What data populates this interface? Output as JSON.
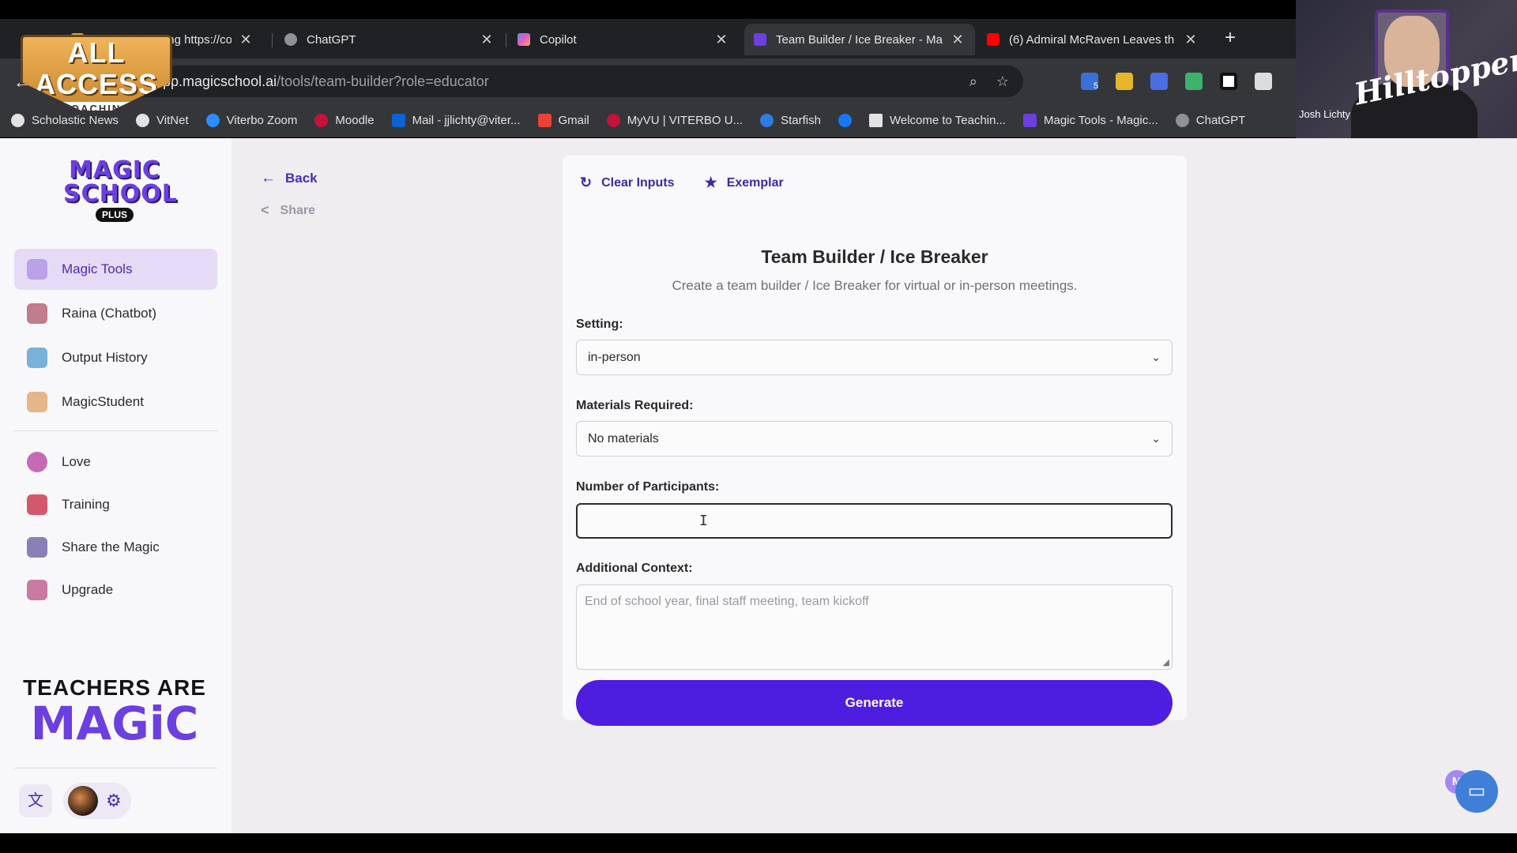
{
  "browser": {
    "tabs": [
      {
        "title": "ALand Coaching https://copilot.",
        "color": "#e4a23b"
      },
      {
        "title": "ChatGPT",
        "color": "#8e9196"
      },
      {
        "title": "Copilot",
        "color": "#5b8ef0"
      },
      {
        "title": "Team Builder / Ice Breaker - Ma",
        "color": "#6b3fe0"
      },
      {
        "title": "(6) Admiral McRaven Leaves th",
        "color": "#ff0000"
      }
    ],
    "new_tab": "+",
    "close_glyph": "✕",
    "url_host": "app.magicschool.ai",
    "url_path": "/tools/team-builder?role=educator",
    "extension_badge": "5",
    "bookmarks": [
      {
        "label": "Scholastic News",
        "color": "#e2e2e2"
      },
      {
        "label": "VitNet",
        "color": "#e2e2e2"
      },
      {
        "label": "Viterbo Zoom",
        "color": "#2d8cff"
      },
      {
        "label": "Moodle",
        "color": "#c4123b"
      },
      {
        "label": "Mail - jjlichty@viter...",
        "color": "#0a64d6"
      },
      {
        "label": "Gmail",
        "color": "#ea4335"
      },
      {
        "label": "MyVU | VITERBO U...",
        "color": "#c4123b"
      },
      {
        "label": "Starfish",
        "color": "#2a7de1"
      },
      {
        "label": "",
        "color": "#1877f2"
      },
      {
        "label": "Welcome to Teachin...",
        "color": "#e2e2e2"
      },
      {
        "label": "Magic Tools - Magic...",
        "color": "#6b3fe0"
      },
      {
        "label": "ChatGPT",
        "color": "#8e9196"
      }
    ]
  },
  "overlay": {
    "logo_line1": "ALL ACCESS",
    "logo_line2": "COACHING",
    "webcam_name": "Josh Lichty",
    "webcam_brand": "Hilltoppers"
  },
  "sidebar": {
    "logo_line1": "MAGIC",
    "logo_line2": "SCHOOL",
    "logo_badge": "PLUS",
    "items": [
      {
        "label": "Magic Tools",
        "color": "#b9a2e8"
      },
      {
        "label": "Raina (Chatbot)",
        "color": "#c07d8a"
      },
      {
        "label": "Output History",
        "color": "#7ab1d8"
      },
      {
        "label": "MagicStudent",
        "color": "#e5b68a"
      }
    ],
    "items2": [
      {
        "label": "Love",
        "color": "#c56bb6"
      },
      {
        "label": "Training",
        "color": "#d4586d"
      },
      {
        "label": "Share the Magic",
        "color": "#8b7fb8"
      },
      {
        "label": "Upgrade",
        "color": "#c97aa3"
      }
    ],
    "tagline_line1": "TEACHERS ARE",
    "tagline_line2": "MAGiC"
  },
  "page": {
    "back_label": "Back",
    "share_label": "Share",
    "clear_label": "Clear Inputs",
    "exemplar_label": "Exemplar",
    "title": "Team Builder / Ice Breaker",
    "subtitle": "Create a team builder / Ice Breaker for virtual or in-person meetings.",
    "setting_label": "Setting:",
    "setting_value": "in-person",
    "materials_label": "Materials Required:",
    "materials_value": "No materials",
    "participants_label": "Number of Participants:",
    "participants_value": "",
    "context_label": "Additional Context:",
    "context_placeholder": "End of school year, final staff meeting, team kickoff",
    "generate_label": "Generate"
  },
  "colors": {
    "accent": "#4d1ee0",
    "accent_text": "#3b2aa6",
    "active_bg": "#e6dbf6"
  }
}
